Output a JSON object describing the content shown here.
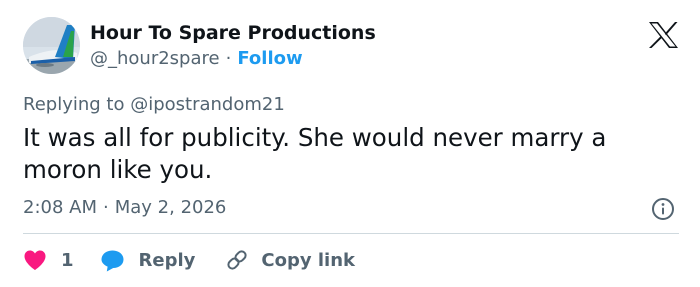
{
  "author": {
    "name": "Hour To Spare Productions",
    "handle": "@_hour2spare",
    "separator": "·",
    "follow_label": "Follow"
  },
  "reply_to": "Replying to @ipostrandom21",
  "tweet": {
    "text": "It was all for publicity. She would never marry a moron like you.",
    "time": "2:08 AM",
    "separator": "·",
    "date": "May 2, 2026"
  },
  "actions": {
    "like_count": "1",
    "reply_label": "Reply",
    "copy_link_label": "Copy link"
  },
  "colors": {
    "link": "#1d9bf0",
    "like": "#f91880",
    "secondary_text": "#536471",
    "divider": "#cfd9de"
  }
}
